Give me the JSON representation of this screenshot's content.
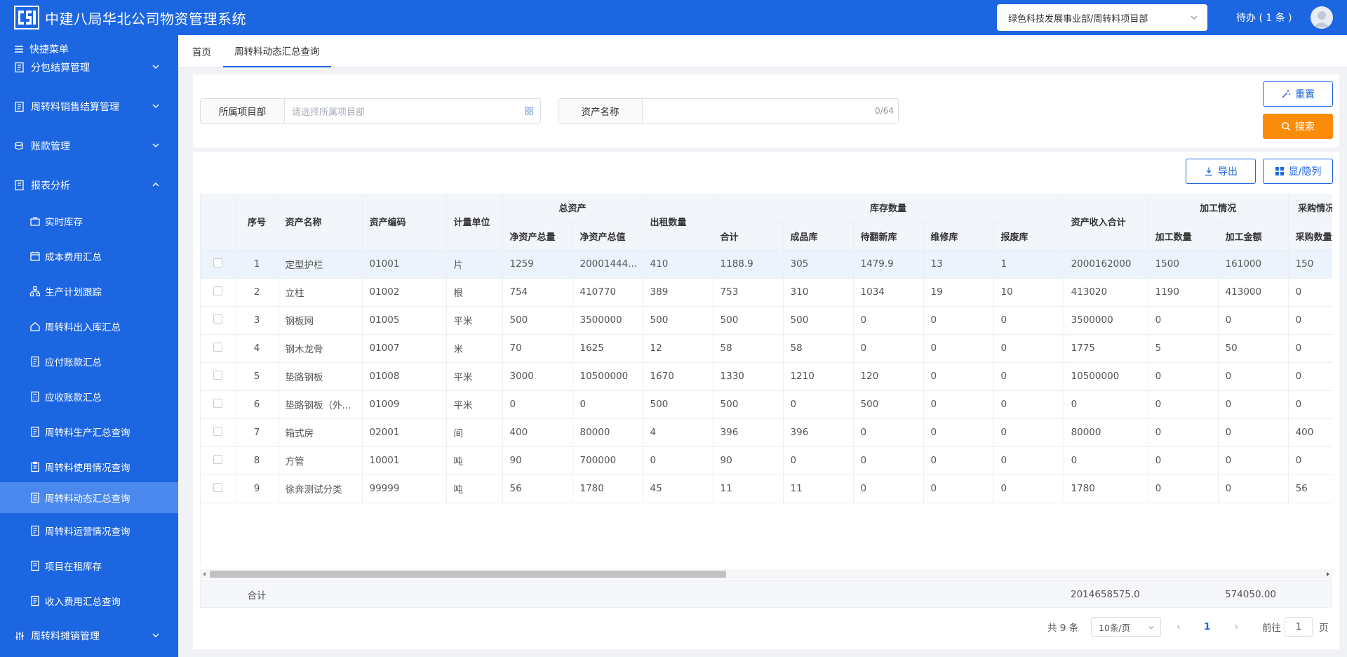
{
  "header": {
    "title": "中建八局华北公司物资管理系统",
    "org_select": "绿色科技发展事业部/周转料项目部",
    "todo": "待办 ( 1 条 )"
  },
  "sidebar": {
    "quick_menu": "快捷菜单",
    "groups": [
      {
        "label": "分包结算管理"
      },
      {
        "label": "周转料销售结算管理"
      },
      {
        "label": "账款管理"
      },
      {
        "label": "报表分析"
      },
      {
        "label": "周转料摊销管理"
      }
    ],
    "items": [
      {
        "label": "实时库存"
      },
      {
        "label": "成本费用汇总"
      },
      {
        "label": "生产计划跟踪"
      },
      {
        "label": "周转料出入库汇总"
      },
      {
        "label": "应付账款汇总"
      },
      {
        "label": "应收账款汇总"
      },
      {
        "label": "周转料生产汇总查询"
      },
      {
        "label": "周转料使用情况查询"
      },
      {
        "label": "周转料动态汇总查询"
      },
      {
        "label": "周转料运营情况查询"
      },
      {
        "label": "项目在租库存"
      },
      {
        "label": "收入费用汇总查询"
      }
    ],
    "active_index": 8
  },
  "tabs": [
    {
      "label": "首页"
    },
    {
      "label": "周转料动态汇总查询"
    }
  ],
  "filters": {
    "project_label": "所属项目部",
    "project_placeholder": "请选择所属项目部",
    "asset_label": "资产名称",
    "asset_count": "0/64",
    "reset": "重置",
    "search": "搜索"
  },
  "toolbar": {
    "export": "导出",
    "toggle_cols": "显/隐列"
  },
  "table": {
    "headers": {
      "seq": "序号",
      "name": "资产名称",
      "code": "资产编码",
      "unit": "计量单位",
      "total_assets": "总资产",
      "net_qty": "净资产总量",
      "net_value": "净资产总值",
      "rent_qty": "出租数量",
      "stock_qty": "库存数量",
      "total": "合计",
      "finished": "成品库",
      "to_renew": "待翻新库",
      "repair": "维修库",
      "scrap": "报废库",
      "income_total": "资产收入合计",
      "processing": "加工情况",
      "proc_qty": "加工数量",
      "proc_amount": "加工金额",
      "purchase": "采购情况",
      "purchase_qty": "采购数量"
    },
    "rows": [
      [
        "1",
        "定型护栏",
        "01001",
        "片",
        "1259",
        "20001444...",
        "410",
        "1188.9",
        "305",
        "1479.9",
        "13",
        "1",
        "2000162000",
        "1500",
        "161000",
        "150"
      ],
      [
        "2",
        "立柱",
        "01002",
        "根",
        "754",
        "410770",
        "389",
        "753",
        "310",
        "1034",
        "19",
        "10",
        "413020",
        "1190",
        "413000",
        "0"
      ],
      [
        "3",
        "钢板网",
        "01005",
        "平米",
        "500",
        "3500000",
        "500",
        "500",
        "500",
        "0",
        "0",
        "0",
        "3500000",
        "0",
        "0",
        "0"
      ],
      [
        "4",
        "钢木龙骨",
        "01007",
        "米",
        "70",
        "1625",
        "12",
        "58",
        "58",
        "0",
        "0",
        "0",
        "1775",
        "5",
        "50",
        "0"
      ],
      [
        "5",
        "垫路钢板",
        "01008",
        "平米",
        "3000",
        "10500000",
        "1670",
        "1330",
        "1210",
        "120",
        "0",
        "0",
        "10500000",
        "0",
        "0",
        "0"
      ],
      [
        "6",
        "垫路钢板（外...",
        "01009",
        "平米",
        "0",
        "0",
        "500",
        "500",
        "0",
        "500",
        "0",
        "0",
        "0",
        "0",
        "0",
        "0"
      ],
      [
        "7",
        "箱式房",
        "02001",
        "间",
        "400",
        "80000",
        "4",
        "396",
        "396",
        "0",
        "0",
        "0",
        "80000",
        "0",
        "0",
        "400"
      ],
      [
        "8",
        "方管",
        "10001",
        "吨",
        "90",
        "700000",
        "0",
        "90",
        "0",
        "0",
        "0",
        "0",
        "0",
        "0",
        "0",
        "0"
      ],
      [
        "9",
        "徐奔测试分类",
        "99999",
        "吨",
        "56",
        "1780",
        "45",
        "11",
        "11",
        "0",
        "0",
        "0",
        "1780",
        "0",
        "0",
        "56"
      ]
    ],
    "summary": {
      "label": "合计",
      "income_total": "2014658575.0",
      "proc_amount": "574050.00"
    }
  },
  "pagination": {
    "total": "共 9 条",
    "page_size": "10条/页",
    "current": "1",
    "goto_label": "前往",
    "goto_value": "1",
    "page_suffix": "页"
  }
}
